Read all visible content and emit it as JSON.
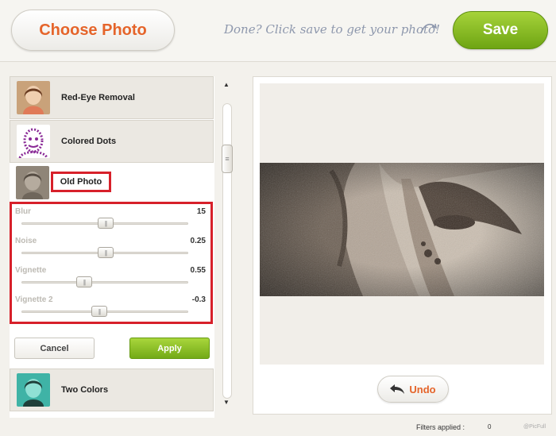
{
  "header": {
    "choose_photo_label": "Choose Photo",
    "hint_text": "Done? Click save to get your photo!",
    "save_label": "Save"
  },
  "filters": [
    {
      "label": "Red-Eye Removal",
      "icon": "portrait-thumbnail"
    },
    {
      "label": "Colored Dots",
      "icon": "dots-portrait-thumbnail"
    },
    {
      "label": "Old Photo",
      "icon": "sepia-portrait-thumbnail",
      "active": true
    },
    {
      "label": "Two Colors",
      "icon": "two-tone-portrait-thumbnail"
    }
  ],
  "params": [
    {
      "name": "Blur",
      "value": "15",
      "level": 0.5
    },
    {
      "name": "Noise",
      "value": "0.25",
      "level": 0.5
    },
    {
      "name": "Vignette",
      "value": "0.55",
      "level": 0.37
    },
    {
      "name": "Vignette 2",
      "value": "-0.3",
      "level": 0.45
    }
  ],
  "actions": {
    "cancel_label": "Cancel",
    "apply_label": "Apply"
  },
  "preview": {
    "undo_label": "Undo"
  },
  "footer": {
    "filters_applied_label": "Filters applied :",
    "filters_applied_count": "0",
    "brand": "@PicFull"
  },
  "colors": {
    "accent_orange": "#e5642a",
    "accent_green": "#7ab51d",
    "highlight_red": "#d7202a"
  }
}
